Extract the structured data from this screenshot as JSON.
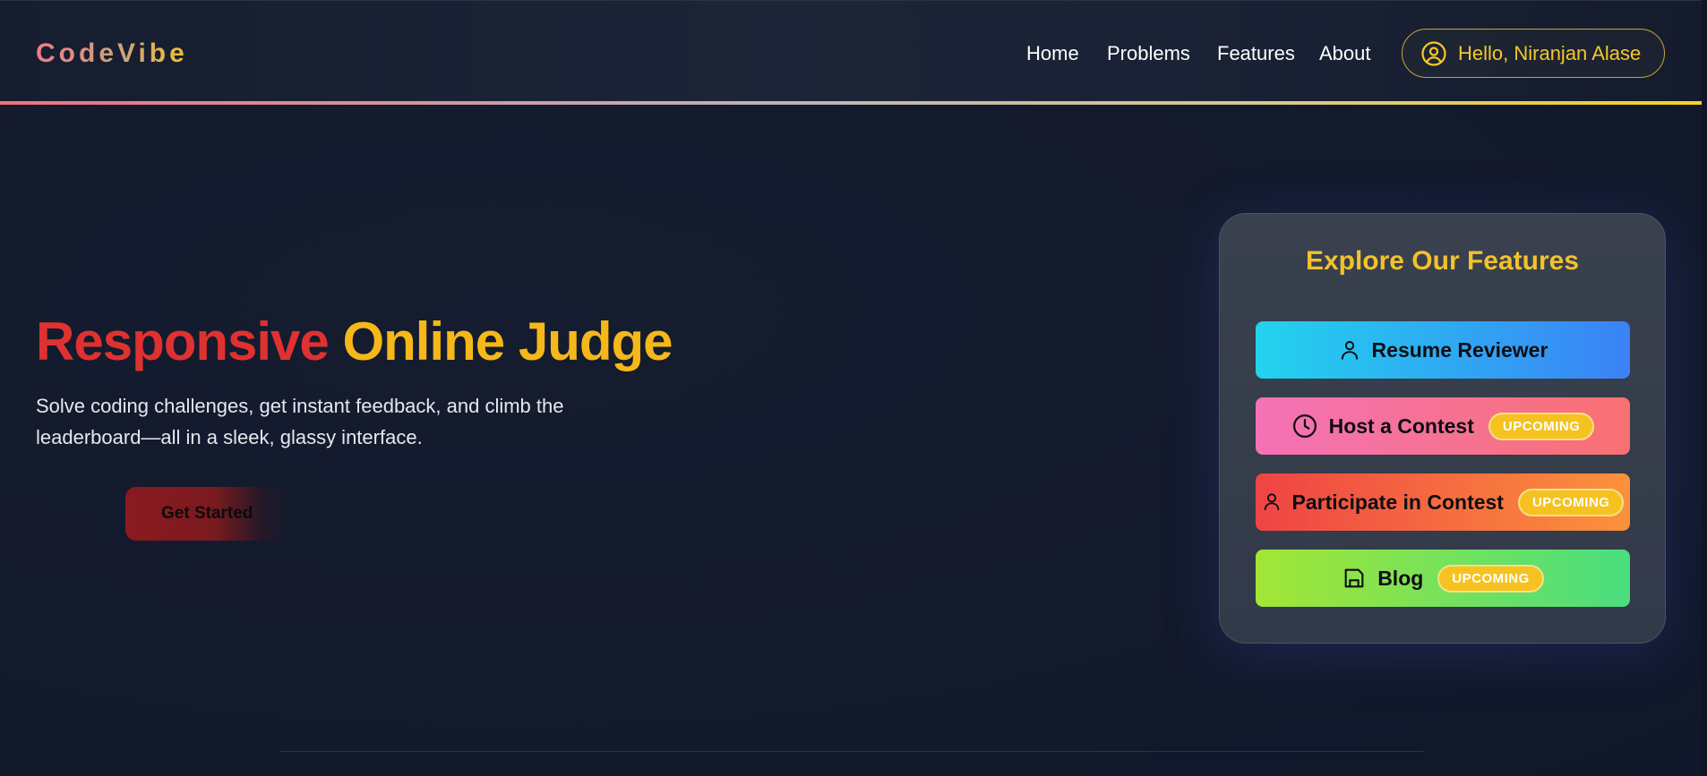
{
  "app": {
    "logo": "CodeVibe"
  },
  "nav": {
    "items": [
      "Home",
      "Problems",
      "Features",
      "About"
    ],
    "user_greeting": "Hello, Niranjan Alase"
  },
  "hero": {
    "title_part1": "Responsive",
    "title_part2": "Online Judge",
    "description": "Solve coding challenges, get instant feedback, and climb the leaderboard—all in a sleek, glassy interface.",
    "cta_label": "Get Started"
  },
  "features": {
    "title": "Explore Our Features",
    "items": [
      {
        "label": "Resume Reviewer",
        "icon": "user-icon",
        "badge": ""
      },
      {
        "label": "Host a Contest",
        "icon": "clock-icon",
        "badge": "UPCOMING"
      },
      {
        "label": "Participate in Contest",
        "icon": "person-icon",
        "badge": "UPCOMING"
      },
      {
        "label": "Blog",
        "icon": "save-icon",
        "badge": "UPCOMING"
      }
    ]
  },
  "colors": {
    "accent_yellow": "#f5b818",
    "accent_red": "#e03131",
    "background": "#141b2e"
  }
}
